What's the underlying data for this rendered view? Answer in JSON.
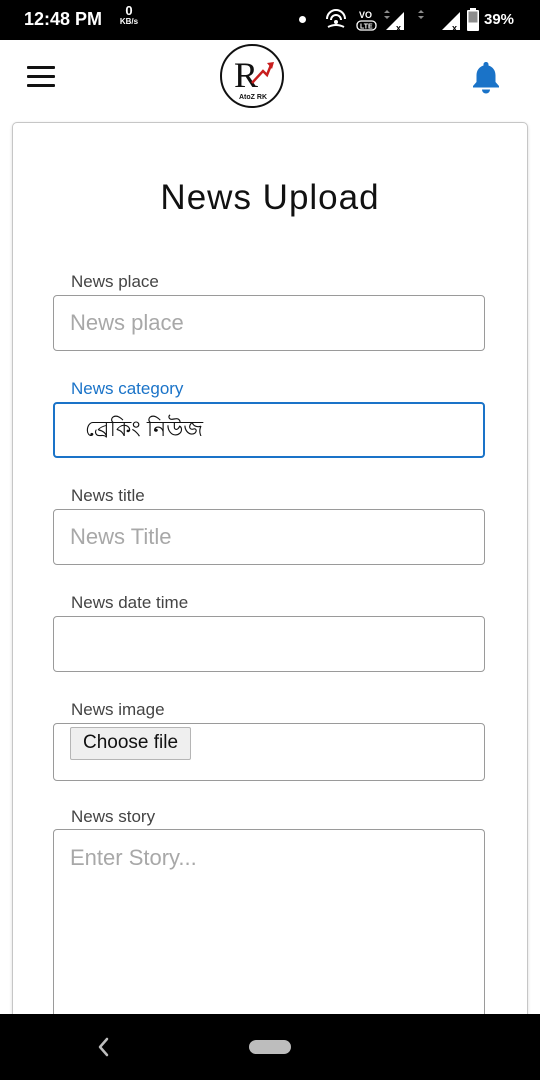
{
  "status_bar": {
    "time": "12:48 PM",
    "net_speed_value": "0",
    "net_speed_unit": "KB/s",
    "volte_label": "VO LTE",
    "battery_percent": "39%",
    "icons": [
      "notification-dot-icon",
      "hotspot-icon",
      "volte-icon",
      "signal-icon",
      "signal-icon",
      "battery-icon"
    ]
  },
  "header": {
    "menu_icon": "hamburger-menu-icon",
    "logo_letter": "R",
    "logo_caption": "AtoZ RK",
    "notification_icon": "bell-icon",
    "accent_color": "#1a73c8"
  },
  "form": {
    "title": "News Upload",
    "place": {
      "label": "News place",
      "placeholder": "News place",
      "value": ""
    },
    "category": {
      "label": "News category",
      "value": "ব্রেকিং নিউজ"
    },
    "title_field": {
      "label": "News title",
      "placeholder": "News Title",
      "value": ""
    },
    "datetime": {
      "label": "News date time",
      "value": ""
    },
    "image": {
      "label": "News image",
      "button_label": "Choose file"
    },
    "story": {
      "label": "News story",
      "placeholder": "Enter Story..."
    }
  },
  "nav_bar": {
    "back_icon": "back-chevron-icon",
    "home_icon": "home-pill-icon"
  }
}
